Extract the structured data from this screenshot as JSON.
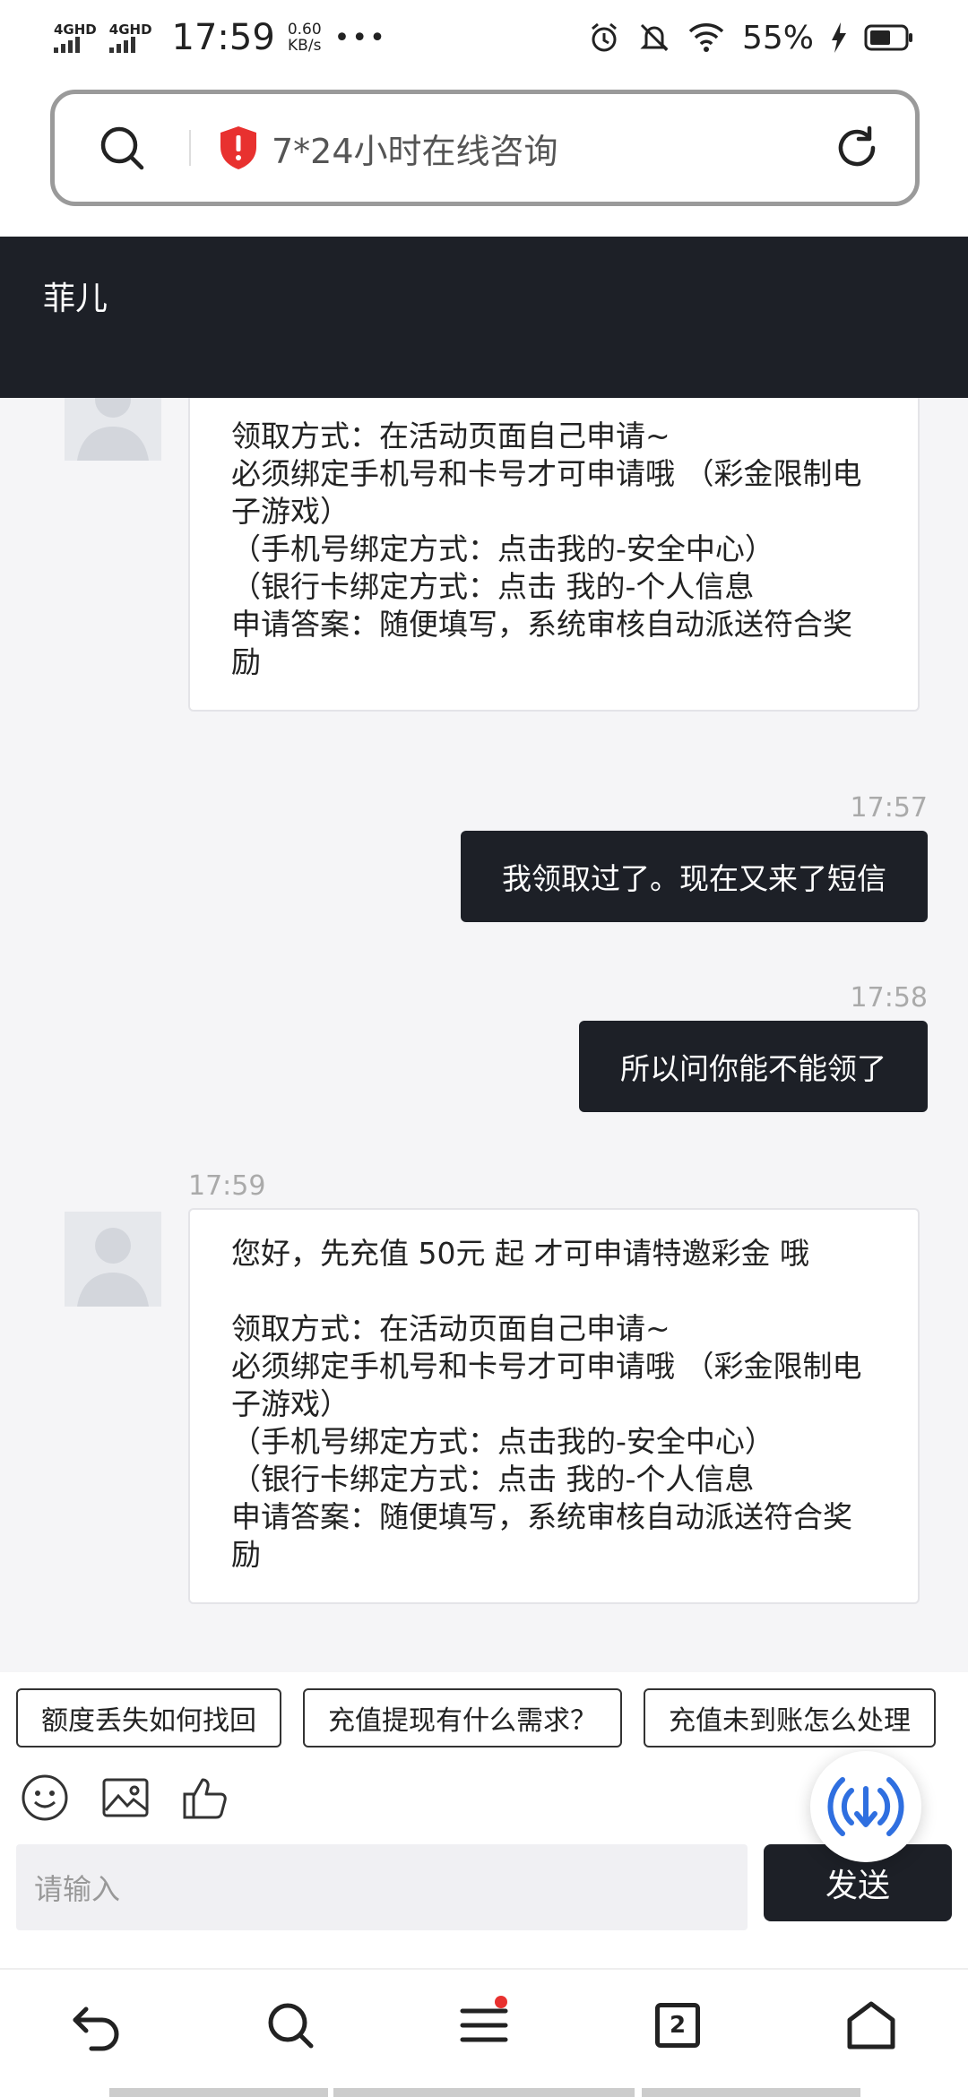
{
  "status_bar": {
    "net1": "4GHD",
    "net2": "4GHD",
    "time": "17:59",
    "speed_value": "0.60",
    "speed_unit": "KB/s",
    "dots": "•••",
    "battery": "55%"
  },
  "url_bar": {
    "text": "7*24小时在线咨询"
  },
  "chat_header": {
    "title": "菲儿"
  },
  "messages": [
    {
      "type": "bot",
      "lines": "领取方式：在活动页面自己申请~\n必须绑定手机号和卡号才可申请哦 （彩金限制电子游戏）\n（手机号绑定方式：点击我的-安全中心）\n（银行卡绑定方式：点击 我的-个人信息\n申请答案：随便填写，系统审核自动派送符合奖励"
    },
    {
      "type": "user",
      "time": "17:57",
      "text": "我领取过了。现在又来了短信"
    },
    {
      "type": "user",
      "time": "17:58",
      "text": "所以问你能不能领了"
    },
    {
      "type": "bot",
      "time": "17:59",
      "lines": "您好，先充值 50元 起 才可申请特邀彩金 哦\n\n领取方式：在活动页面自己申请~\n必须绑定手机号和卡号才可申请哦 （彩金限制电子游戏）\n（手机号绑定方式：点击我的-安全中心）\n（银行卡绑定方式：点击 我的-个人信息\n申请答案：随便填写，系统审核自动派送符合奖励"
    }
  ],
  "quick_replies": [
    "额度丢失如何找回",
    "充值提现有什么需求？",
    "充值未到账怎么处理"
  ],
  "input": {
    "placeholder": "请输入",
    "send_label": "发送"
  },
  "nav": {
    "tab_count": "2"
  },
  "colors": {
    "dark": "#1d2027",
    "shield_red": "#e8312f",
    "fab_blue": "#2f6fe0"
  }
}
